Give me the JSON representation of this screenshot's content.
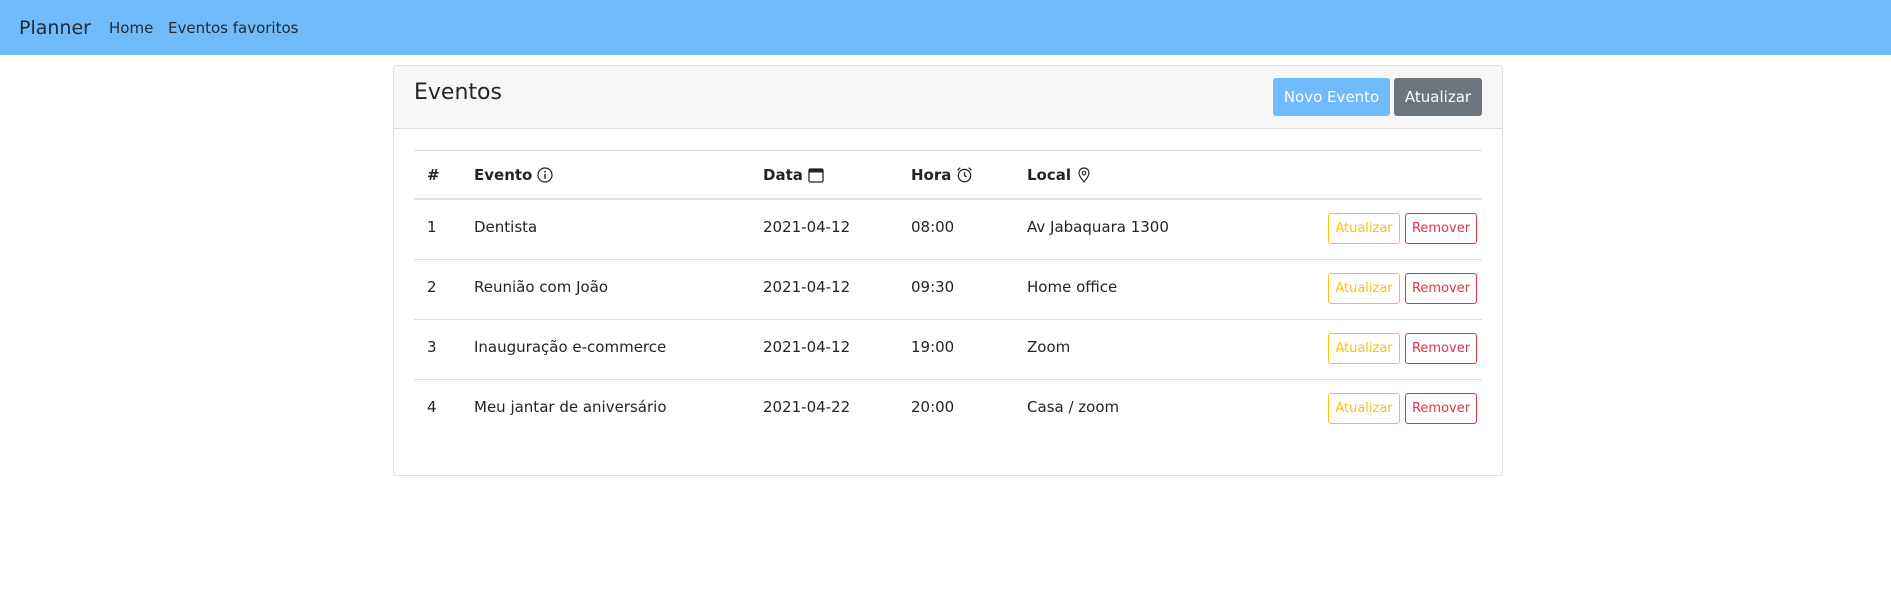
{
  "navbar": {
    "brand": "Planner",
    "links": [
      "Home",
      "Eventos favoritos"
    ],
    "background": "#6fbbfc"
  },
  "card": {
    "title": "Eventos",
    "new_button": "Novo Evento",
    "refresh_button": "Atualizar"
  },
  "table": {
    "headers": {
      "num": "#",
      "event": "Evento",
      "date": "Data",
      "hour": "Hora",
      "location": "Local"
    },
    "header_icons": {
      "event": "info-icon",
      "date": "calendar-icon",
      "hour": "alarm-clock-icon",
      "location": "map-pin-icon"
    },
    "rows": [
      {
        "num": "1",
        "event": "Dentista",
        "date": "2021-04-12",
        "hour": "08:00",
        "location": "Av Jabaquara 1300",
        "update": "Atualizar",
        "remove": "Remover"
      },
      {
        "num": "2",
        "event": "Reunião com João",
        "date": "2021-04-12",
        "hour": "09:30",
        "location": "Home office",
        "update": "Atualizar",
        "remove": "Remover"
      },
      {
        "num": "3",
        "event": "Inauguração e-commerce",
        "date": "2021-04-12",
        "hour": "19:00",
        "location": "Zoom",
        "update": "Atualizar",
        "remove": "Remover"
      },
      {
        "num": "4",
        "event": "Meu jantar de aniversário",
        "date": "2021-04-22",
        "hour": "20:00",
        "location": "Casa / zoom",
        "update": "Atualizar",
        "remove": "Remover"
      }
    ]
  },
  "colors": {
    "primary": "#70bbfb",
    "secondary": "#6c757d",
    "warning": "#ffc107",
    "danger": "#dc3545"
  }
}
